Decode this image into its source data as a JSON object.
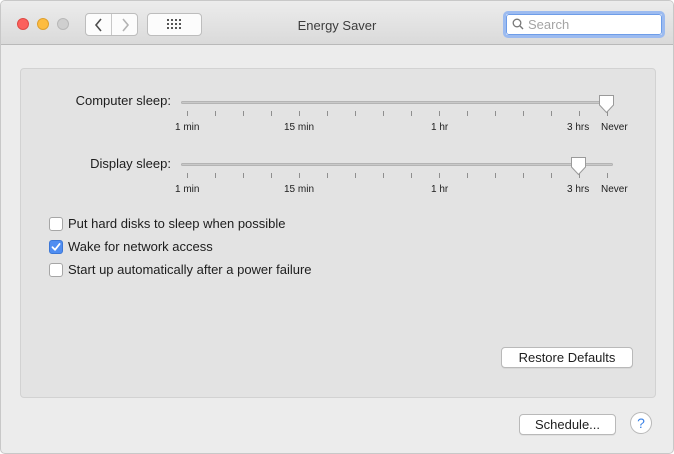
{
  "window": {
    "title": "Energy Saver"
  },
  "search": {
    "placeholder": "Search",
    "value": ""
  },
  "icons": {
    "back": "chevron-left-icon",
    "forward": "chevron-right-icon",
    "show_all": "grid-icon",
    "search": "search-icon",
    "checkmark": "checkmark-icon",
    "help": "question-mark-icon"
  },
  "sliders": [
    {
      "label": "Computer sleep:",
      "value": "Never",
      "ticks": [
        "1 min",
        "15 min",
        "1 hr",
        "3 hrs",
        "Never"
      ]
    },
    {
      "label": "Display sleep:",
      "value": "3 hrs",
      "ticks": [
        "1 min",
        "15 min",
        "1 hr",
        "3 hrs",
        "Never"
      ]
    }
  ],
  "options": [
    {
      "label": "Put hard disks to sleep when possible",
      "checked": false
    },
    {
      "label": "Wake for network access",
      "checked": true
    },
    {
      "label": "Start up automatically after a power failure",
      "checked": false
    }
  ],
  "buttons": {
    "restore_defaults": "Restore Defaults",
    "schedule": "Schedule...",
    "help": "?"
  },
  "colors": {
    "accent": "#4f8df1",
    "close": "#fc605c",
    "minimize": "#fdbc40",
    "zoom_disabled": "#cfcfcf"
  }
}
